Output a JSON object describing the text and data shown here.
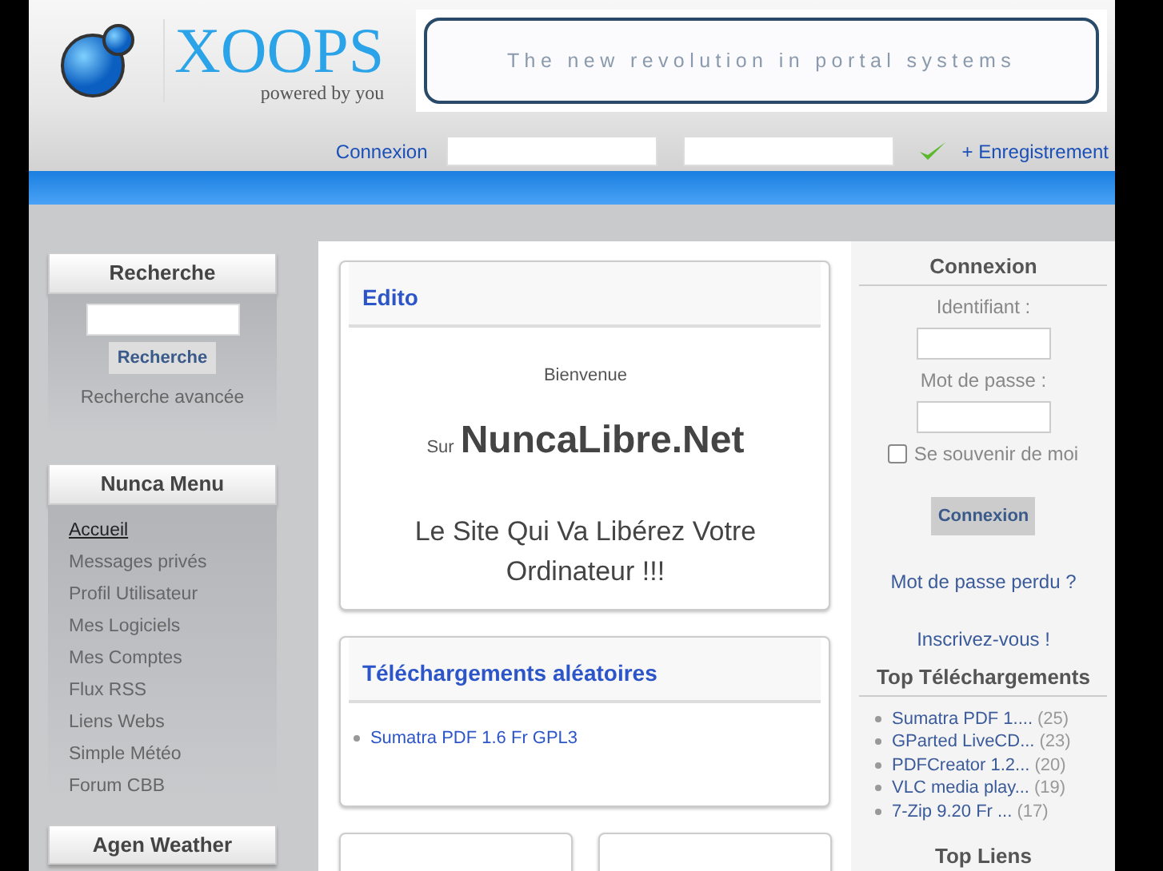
{
  "header": {
    "logo_text": "XOOPS",
    "logo_tagline": "powered by you",
    "banner_text": "The new revolution in portal systems",
    "login_label": "Connexion",
    "register_link": "+ Enregistrement"
  },
  "left": {
    "search": {
      "title": "Recherche",
      "button": "Recherche",
      "advanced_link": "Recherche avancée"
    },
    "menu": {
      "title": "Nunca Menu",
      "items": [
        {
          "label": "Accueil",
          "selected": true
        },
        {
          "label": "Messages privés",
          "selected": false
        },
        {
          "label": "Profil Utilisateur",
          "selected": false
        },
        {
          "label": "Mes Logiciels",
          "selected": false
        },
        {
          "label": "Mes Comptes",
          "selected": false
        },
        {
          "label": "Flux RSS",
          "selected": false
        },
        {
          "label": "Liens Webs",
          "selected": false
        },
        {
          "label": "Simple Météo",
          "selected": false
        },
        {
          "label": "Forum CBB",
          "selected": false
        }
      ]
    },
    "weather": {
      "title": "Agen Weather"
    }
  },
  "center": {
    "edito": {
      "title": "Edito",
      "welcome": "Bienvenue",
      "sur": "Sur",
      "site_name": "NuncaLibre.Net",
      "slogan": "Le Site Qui Va Libérez Votre Ordinateur !!!"
    },
    "downloads": {
      "title": "Téléchargements aléatoires",
      "items": [
        "Sumatra PDF 1.6 Fr GPL3"
      ]
    }
  },
  "right": {
    "login": {
      "title": "Connexion",
      "user_label": "Identifiant :",
      "pass_label": "Mot de passe :",
      "remember_label": "Se souvenir de moi",
      "remember_checked": false,
      "button": "Connexion",
      "lost_link": "Mot de passe perdu ?",
      "register_link": "Inscrivez-vous !"
    },
    "top_downloads": {
      "title": "Top Téléchargements",
      "items": [
        {
          "name": "Sumatra PDF 1....",
          "count": "(25)"
        },
        {
          "name": "GParted LiveCD...",
          "count": "(23)"
        },
        {
          "name": "PDFCreator 1.2...",
          "count": "(20)"
        },
        {
          "name": "VLC media play...",
          "count": "(19)"
        },
        {
          "name": "7-Zip 9.20 Fr ...",
          "count": "(17)"
        }
      ]
    },
    "top_links": {
      "title": "Top Liens"
    }
  }
}
